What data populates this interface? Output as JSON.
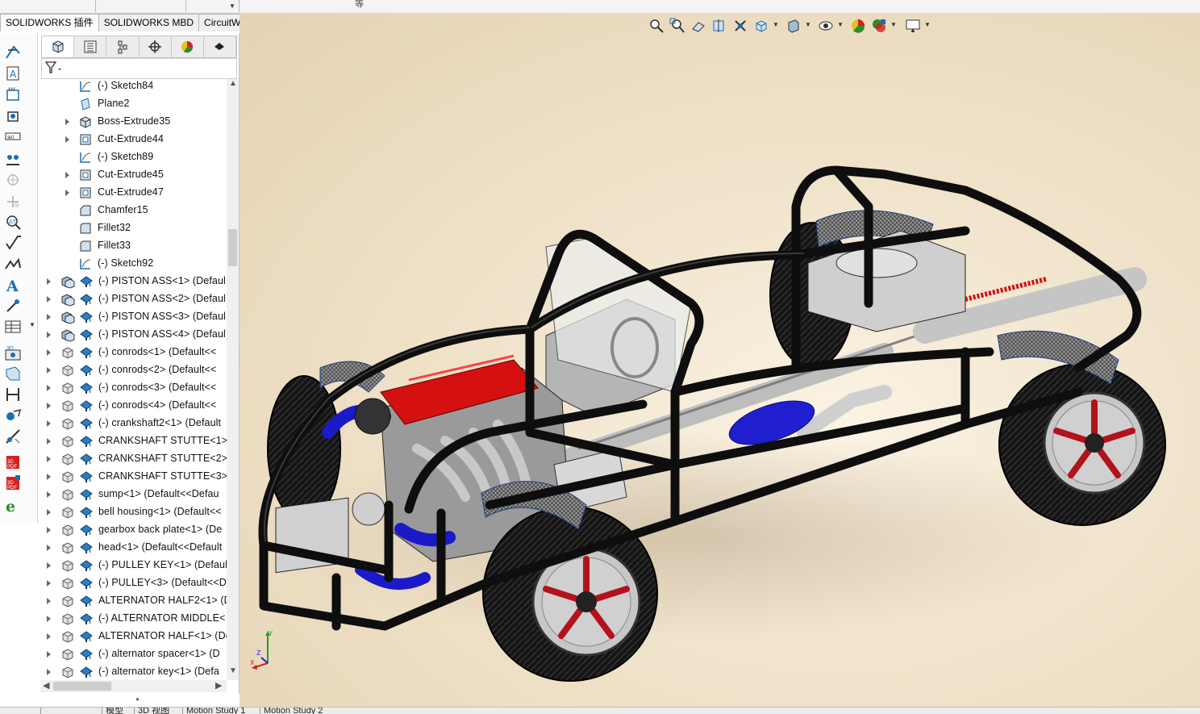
{
  "top_strip": {
    "fragment": "等"
  },
  "command_tabs": [
    {
      "label": "SOLIDWORKS 插件",
      "active": true
    },
    {
      "label": "SOLIDWORKS MBD",
      "active": false
    },
    {
      "label": "CircuitWorks",
      "active": false
    }
  ],
  "panel_tabs": [
    {
      "name": "feature-manager-icon",
      "active": true
    },
    {
      "name": "property-manager-icon",
      "active": false
    },
    {
      "name": "configuration-manager-icon",
      "active": false
    },
    {
      "name": "dimxpert-manager-icon",
      "active": false
    },
    {
      "name": "display-manager-icon",
      "active": false
    },
    {
      "name": "cam-manager-icon",
      "active": false
    }
  ],
  "tree": {
    "rows": [
      {
        "label": "(-) Sketch84",
        "type": "sketch",
        "expandable": false,
        "level": 1
      },
      {
        "label": "Plane2",
        "type": "plane",
        "expandable": false,
        "level": 1
      },
      {
        "label": "Boss-Extrude35",
        "type": "boss",
        "expandable": true,
        "level": 1
      },
      {
        "label": "Cut-Extrude44",
        "type": "cut",
        "expandable": true,
        "level": 1
      },
      {
        "label": "(-) Sketch89",
        "type": "sketch",
        "expandable": false,
        "level": 1
      },
      {
        "label": "Cut-Extrude45",
        "type": "cut",
        "expandable": true,
        "level": 1
      },
      {
        "label": "Cut-Extrude47",
        "type": "cut",
        "expandable": true,
        "level": 1
      },
      {
        "label": "Chamfer15",
        "type": "chamfer",
        "expandable": false,
        "level": 1
      },
      {
        "label": "Fillet32",
        "type": "fillet",
        "expandable": false,
        "level": 1
      },
      {
        "label": "Fillet33",
        "type": "fillet",
        "expandable": false,
        "level": 1
      },
      {
        "label": "(-) Sketch92",
        "type": "sketch",
        "expandable": false,
        "level": 1
      },
      {
        "label": "(-) PISTON ASS<1> (Defaul",
        "type": "assembly",
        "expandable": true,
        "level": 0
      },
      {
        "label": "(-) PISTON ASS<2> (Defaul",
        "type": "assembly",
        "expandable": true,
        "level": 0
      },
      {
        "label": "(-) PISTON ASS<3> (Defaul",
        "type": "assembly",
        "expandable": true,
        "level": 0
      },
      {
        "label": "(-) PISTON ASS<4> (Defaul",
        "type": "assembly",
        "expandable": true,
        "level": 0
      },
      {
        "label": "(-) conrods<1> (Default<<",
        "type": "part",
        "expandable": true,
        "level": 0
      },
      {
        "label": "(-) conrods<2> (Default<<",
        "type": "part",
        "expandable": true,
        "level": 0
      },
      {
        "label": "(-) conrods<3> (Default<<",
        "type": "part",
        "expandable": true,
        "level": 0
      },
      {
        "label": "(-) conrods<4> (Default<<",
        "type": "part",
        "expandable": true,
        "level": 0
      },
      {
        "label": "(-) crankshaft2<1> (Default",
        "type": "part",
        "expandable": true,
        "level": 0
      },
      {
        "label": "CRANKSHAFT STUTTE<1> (",
        "type": "part",
        "expandable": true,
        "level": 0
      },
      {
        "label": "CRANKSHAFT STUTTE<2> (",
        "type": "part",
        "expandable": true,
        "level": 0
      },
      {
        "label": "CRANKSHAFT STUTTE<3> (",
        "type": "part",
        "expandable": true,
        "level": 0
      },
      {
        "label": "sump<1> (Default<<Defau",
        "type": "part",
        "expandable": true,
        "level": 0
      },
      {
        "label": "bell housing<1> (Default<<",
        "type": "part",
        "expandable": true,
        "level": 0
      },
      {
        "label": "gearbox back plate<1> (De",
        "type": "part",
        "expandable": true,
        "level": 0
      },
      {
        "label": "head<1> (Default<<Default",
        "type": "part",
        "expandable": true,
        "level": 0
      },
      {
        "label": "(-) PULLEY KEY<1> (Default",
        "type": "part",
        "expandable": true,
        "level": 0
      },
      {
        "label": "(-) PULLEY<3> (Default<<D",
        "type": "part",
        "expandable": true,
        "level": 0
      },
      {
        "label": "ALTERNATOR HALF2<1> (D",
        "type": "part",
        "expandable": true,
        "level": 0
      },
      {
        "label": "(-) ALTERNATOR MIDDLE<",
        "type": "part",
        "expandable": true,
        "level": 0
      },
      {
        "label": "ALTERNATOR HALF<1> (De",
        "type": "part",
        "expandable": true,
        "level": 0
      },
      {
        "label": "(-) alternator spacer<1> (D",
        "type": "part",
        "expandable": true,
        "level": 0
      },
      {
        "label": "(-) alternator key<1> (Defa",
        "type": "part",
        "expandable": true,
        "level": 0
      }
    ]
  },
  "bottom_tabs": [
    "",
    "模型",
    "3D 视图",
    "Motion Study 1",
    "Motion Study 2"
  ],
  "hud_buttons": [
    "zoom-to-fit-icon",
    "zoom-to-area-icon",
    "previous-view-icon",
    "section-view-icon",
    "dynamic-annotation-icon",
    "view-orientation-icon",
    "display-style-icon",
    "hide-show-items-icon",
    "edit-appearance-icon",
    "apply-scene-icon",
    "view-settings-icon"
  ],
  "colors": {
    "frame": "#111111",
    "engine_red": "#d41010",
    "hose_blue": "#1a1ac8",
    "rim_red": "#b3121a",
    "metal": "#c9c9c9"
  }
}
